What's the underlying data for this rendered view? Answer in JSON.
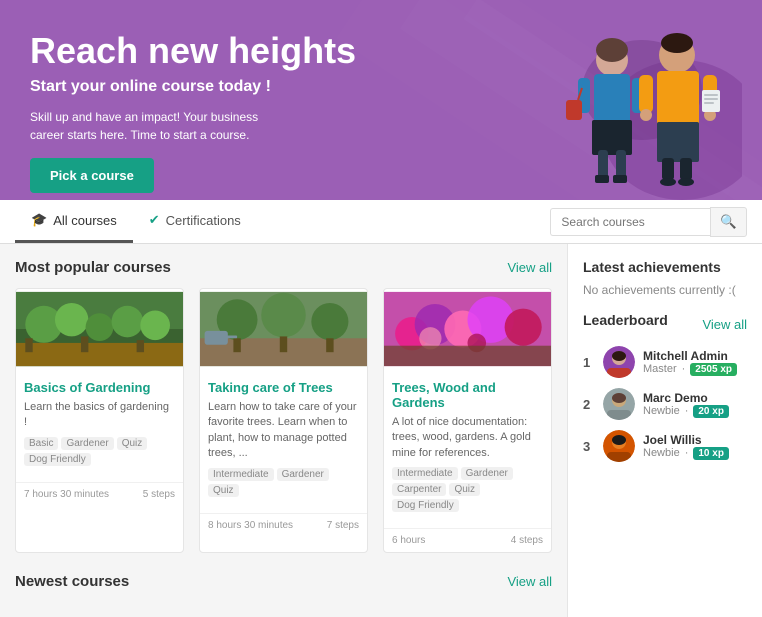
{
  "hero": {
    "title": "Reach new heights",
    "subtitle": "Start your online course today !",
    "description": "Skill up and have an impact! Your business career starts here. Time to start a course.",
    "cta_label": "Pick a course",
    "bg_color": "#9b5fb5"
  },
  "navbar": {
    "tab_courses": "All courses",
    "tab_certifications": "Certifications",
    "search_placeholder": "Search courses"
  },
  "popular_section": {
    "title": "Most popular courses",
    "view_all": "View all"
  },
  "courses": [
    {
      "title": "Basics of Gardening",
      "description": "Learn the basics of gardening !",
      "tags": [
        "Basic",
        "Gardener",
        "Quiz",
        "Dog Friendly"
      ],
      "duration": "7 hours 30 minutes",
      "steps": "5 steps",
      "img_color": "#5a8a3c"
    },
    {
      "title": "Taking care of Trees",
      "description": "Learn how to take care of your favorite trees. Learn when to plant, how to manage potted trees, ...",
      "tags": [
        "Intermediate",
        "Gardener",
        "Quiz"
      ],
      "duration": "8 hours 30 minutes",
      "steps": "7 steps",
      "img_color": "#4a7a2c"
    },
    {
      "title": "Trees, Wood and Gardens",
      "description": "A lot of nice documentation: trees, wood, gardens. A gold mine for references.",
      "tags": [
        "Intermediate",
        "Gardener",
        "Carpenter",
        "Quiz",
        "Dog Friendly"
      ],
      "duration": "6 hours",
      "steps": "4 steps",
      "img_color": "#c0399b"
    }
  ],
  "sidebar": {
    "achievements_title": "Latest achievements",
    "no_achievements": "No achievements currently :(",
    "leaderboard_title": "Leaderboard",
    "view_all": "View all",
    "leaderboard": [
      {
        "rank": 1,
        "name": "Mitchell Admin",
        "level": "Master",
        "xp": "2505 xp",
        "xp_class": "xp-green",
        "avatar_color": "#c0392b",
        "avatar_bg": "#8e44ad"
      },
      {
        "rank": 2,
        "name": "Marc Demo",
        "level": "Newbie",
        "xp": "20 xp",
        "xp_class": "xp-teal",
        "avatar_color": "#7f8c8d",
        "avatar_bg": "#95a5a6"
      },
      {
        "rank": 3,
        "name": "Joel Willis",
        "level": "Newbie",
        "xp": "10 xp",
        "xp_class": "xp-teal",
        "avatar_color": "#e67e22",
        "avatar_bg": "#d35400"
      }
    ]
  },
  "newest_section": {
    "title": "Newest courses",
    "view_all": "View all"
  },
  "icons": {
    "graduation": "🎓",
    "certificate": "✔",
    "search": "🔍"
  }
}
